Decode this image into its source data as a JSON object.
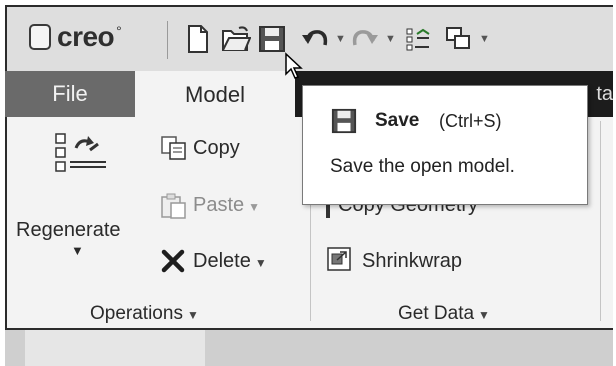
{
  "app": {
    "name": "creo",
    "mark": "°"
  },
  "quick_access": {
    "icons": [
      "new-file-icon",
      "open-folder-icon",
      "save-icon",
      "undo-icon",
      "redo-icon",
      "regenerate-small-icon",
      "windows-icon"
    ]
  },
  "tabs": [
    {
      "label": "File"
    },
    {
      "label": "Model"
    },
    {
      "label": "ta"
    }
  ],
  "ribbon": {
    "operations": {
      "regenerate_label": "Regenerate",
      "copy_label": "Copy",
      "paste_label": "Paste",
      "delete_label": "Delete",
      "group_label": "Operations"
    },
    "get_data": {
      "copy_geometry_label": "Copy Geometry",
      "shrinkwrap_label": "Shrinkwrap",
      "group_label": "Get Data"
    }
  },
  "tooltip": {
    "title": "Save",
    "shortcut": "(Ctrl+S)",
    "description": "Save the open model."
  },
  "colors": {
    "tab_bar": "#1c1c1c",
    "file_tab": "#6a6a6a",
    "ribbon_bg": "#f3f3f3",
    "toolbar_bg": "#dedede"
  }
}
